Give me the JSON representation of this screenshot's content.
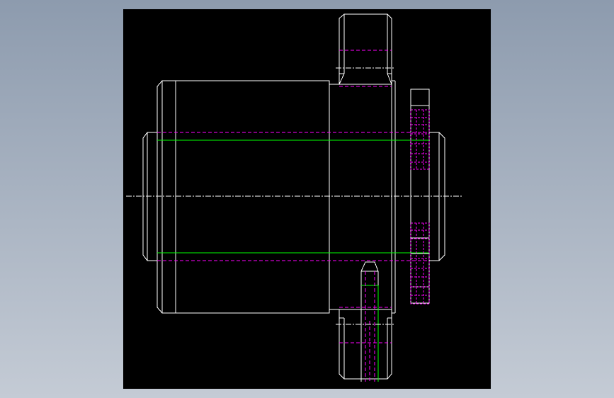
{
  "viewer": {
    "background_top": "#8d9bae",
    "background_bottom": "#c4cbd5",
    "canvas_color": "#000000"
  },
  "drawing": {
    "colors": {
      "outline": "#ffffff",
      "hidden": "#ff00ff",
      "thread": "#00ff00",
      "centerline": "#ffffff"
    },
    "views": [
      "coupling-hub-side-view"
    ]
  }
}
